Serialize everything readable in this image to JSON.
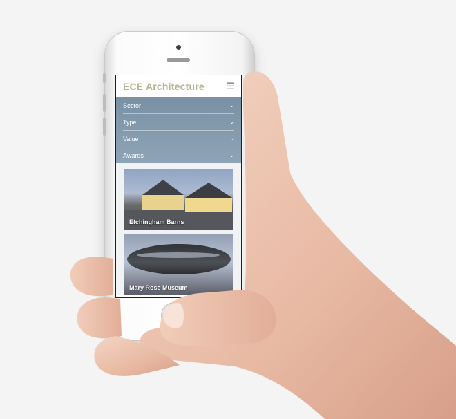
{
  "app": {
    "title": "ECE Architecture",
    "menu_icon": "hamburger-menu-icon"
  },
  "filters": [
    {
      "label": "Sector",
      "icon": "chevron-down-icon"
    },
    {
      "label": "Type",
      "icon": "chevron-down-icon"
    },
    {
      "label": "Value",
      "icon": "chevron-down-icon"
    },
    {
      "label": "Awards",
      "icon": "chevron-down-icon"
    }
  ],
  "projects": [
    {
      "label": "Etchingham Barns"
    },
    {
      "label": "Mary Rose Museum"
    }
  ],
  "colors": {
    "title": "#b6b48f",
    "filter_panel": "#8298ab",
    "background": "#f4f4f4"
  }
}
